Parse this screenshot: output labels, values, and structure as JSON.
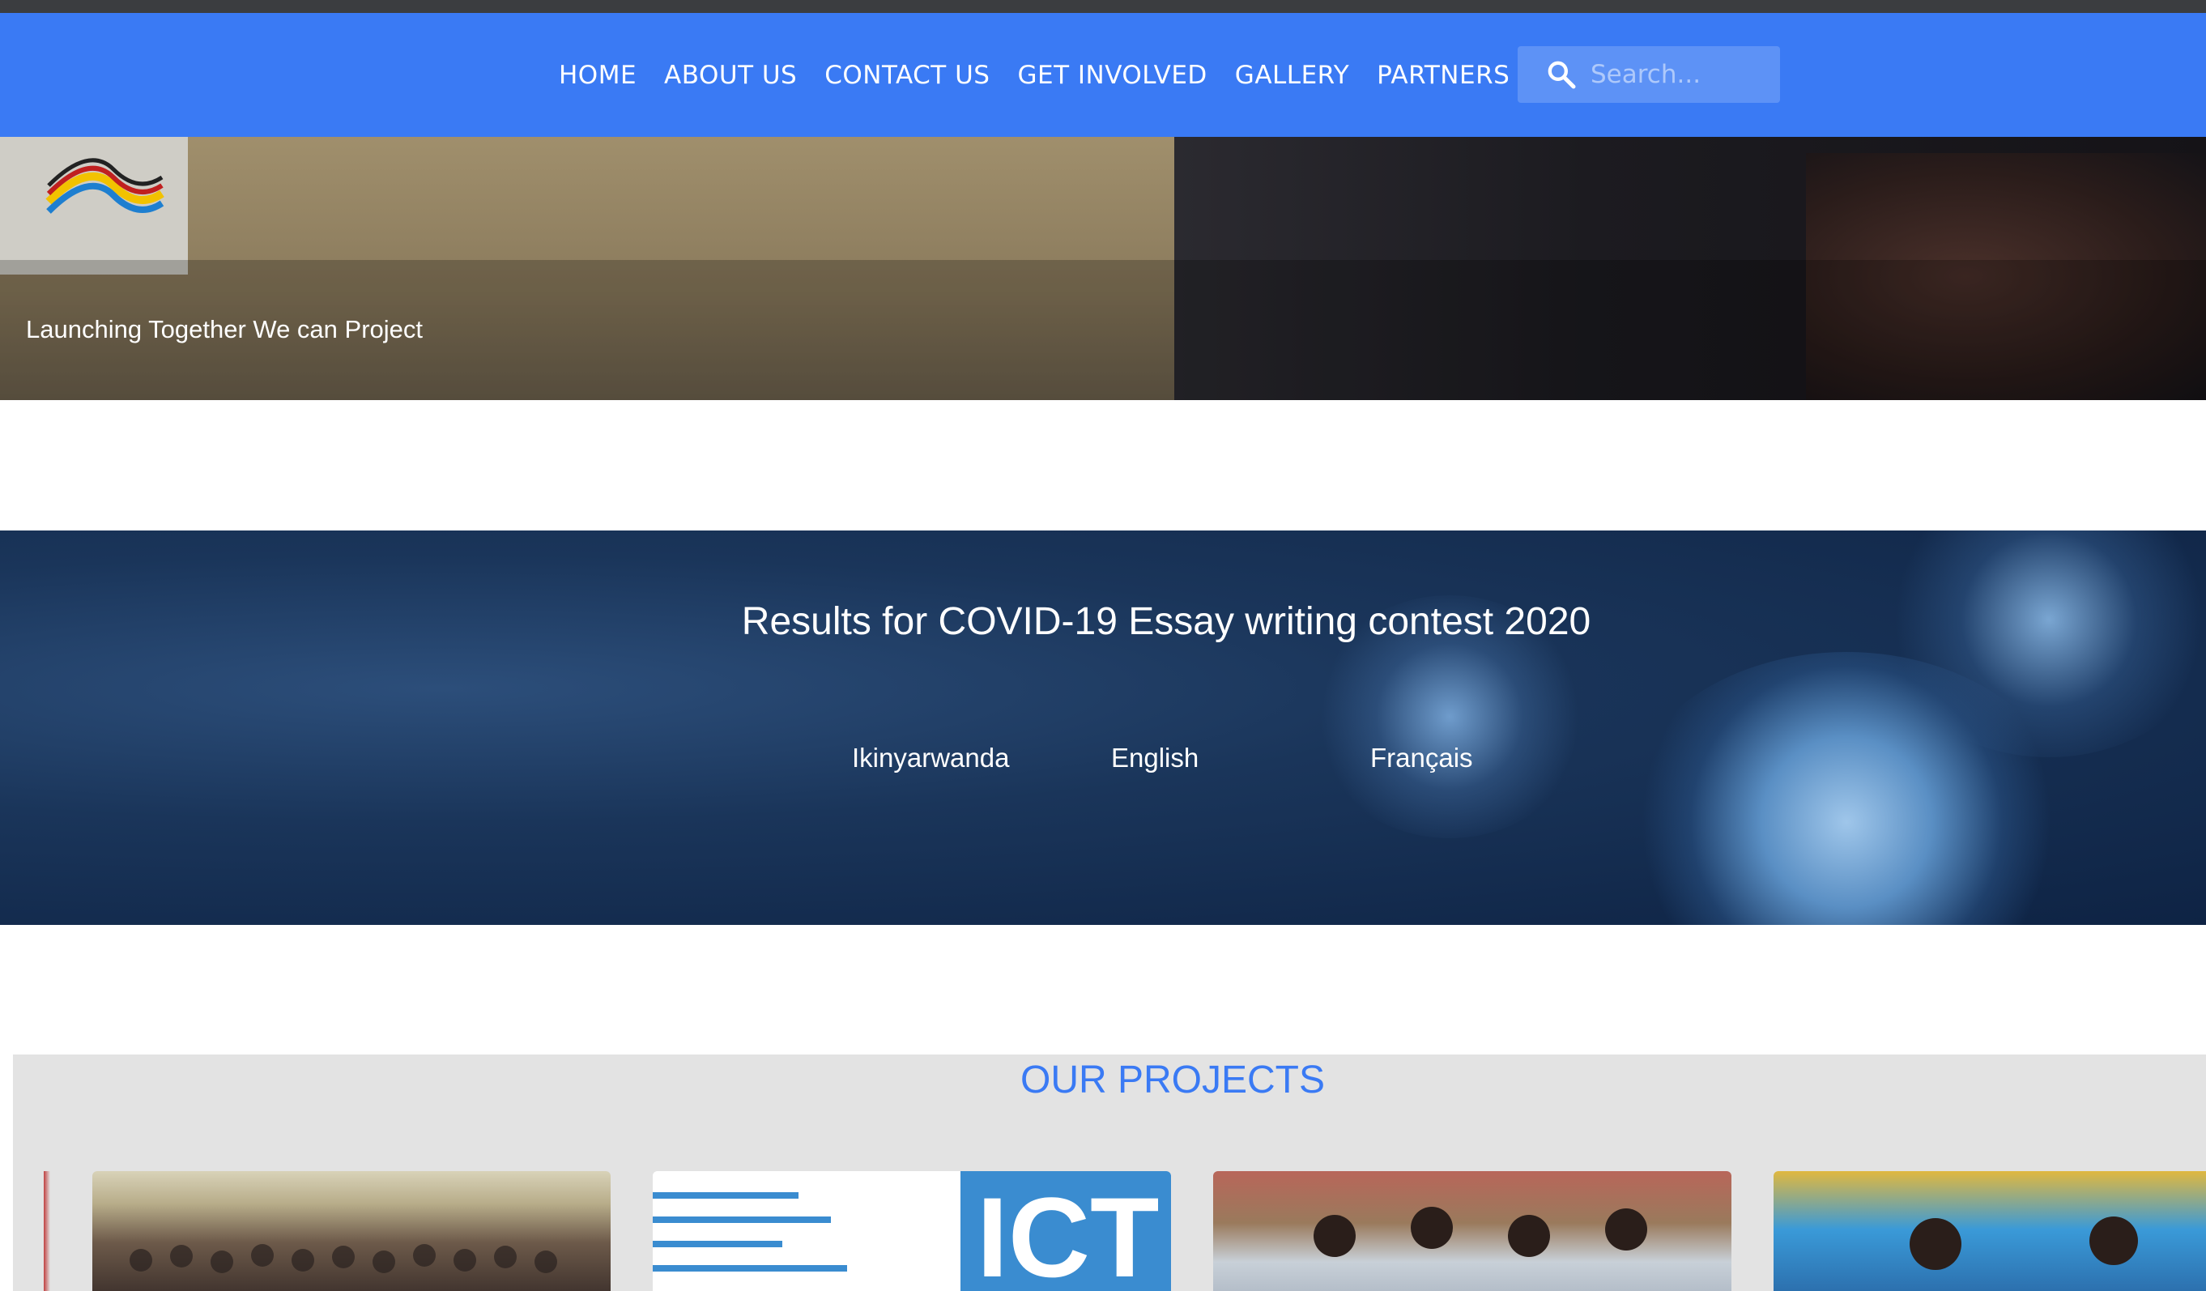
{
  "nav": {
    "items": [
      {
        "label": "HOME"
      },
      {
        "label": "ABOUT US"
      },
      {
        "label": "CONTACT US"
      },
      {
        "label": "GET INVOLVED"
      },
      {
        "label": "GALLERY"
      },
      {
        "label": "PARTNERS"
      }
    ],
    "search_placeholder": "Search...",
    "search_icon": "search-icon"
  },
  "hero": {
    "caption": "Launching Together We can Project"
  },
  "covid": {
    "title": "Results for COVID-19 Essay writing contest 2020",
    "languages": [
      {
        "label": "Ikinyarwanda"
      },
      {
        "label": "English"
      },
      {
        "label": "Français"
      }
    ]
  },
  "projects": {
    "title": "OUR PROJECTS",
    "cards": [
      {
        "name": "project-card-conference"
      },
      {
        "name": "project-card-ict",
        "image_text": "ICT"
      },
      {
        "name": "project-card-children"
      },
      {
        "name": "project-card-celebration"
      }
    ]
  },
  "colors": {
    "brand_blue": "#3a7af4",
    "nav_text": "#ffffff",
    "projects_bg": "#e3e3e3"
  }
}
